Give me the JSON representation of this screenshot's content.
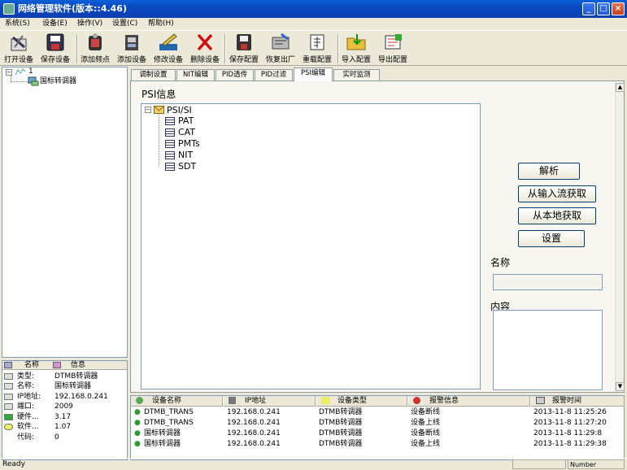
{
  "window": {
    "title": "网络管理软件(版本::4.46)",
    "min": "_",
    "max": "□",
    "close": "×"
  },
  "menu": [
    "系统(S)",
    "设备(E)",
    "操作(V)",
    "设置(C)",
    "帮助(H)"
  ],
  "toolbar": [
    "打开设备",
    "保存设备",
    "添加频点",
    "添加设备",
    "修改设备",
    "删除设备",
    "保存配置",
    "恢复出厂",
    "重载配置",
    "导入配置",
    "导出配置"
  ],
  "tree": {
    "root": "1",
    "child": "国标转调器"
  },
  "props": {
    "col1": "名称",
    "col2": "信息",
    "rows": [
      [
        "类型:",
        "DTMB转调器"
      ],
      [
        "名称:",
        "国标转调器"
      ],
      [
        "IP地址:",
        "192.168.0.241"
      ],
      [
        "端口:",
        "2009"
      ],
      [
        "硬件...",
        "3.17"
      ],
      [
        "软件...",
        "1.07"
      ],
      [
        "代码:",
        "0"
      ]
    ]
  },
  "tabs": [
    "调制设置",
    "NIT编辑",
    "PID透传",
    "PID过滤",
    "PSI编辑",
    "实时监测"
  ],
  "psi": {
    "title": "PSI信息",
    "root": "PSI/SI",
    "items": [
      "PAT",
      "CAT",
      "PMTs",
      "NIT",
      "SDT"
    ]
  },
  "buttons": {
    "parse": "解析",
    "from_input": "从输入流获取",
    "from_local": "从本地获取",
    "set": "设置"
  },
  "labels": {
    "name": "名称",
    "content": "内容"
  },
  "alarms": {
    "headers": [
      "设备名称",
      "IP地址",
      "设备类型",
      "报警信息",
      "报警时间"
    ],
    "rows": [
      [
        "DTMB_TRANS",
        "192.168.0.241",
        "DTMB转调器",
        "设备断线",
        "2013-11-8 11:25:26"
      ],
      [
        "DTMB_TRANS",
        "192.168.0.241",
        "DTMB转调器",
        "设备上线",
        "2013-11-8 11:27:20"
      ],
      [
        "国标转调器",
        "192.168.0.241",
        "DTMB转调器",
        "设备断线",
        "2013-11-8 11:29:8"
      ],
      [
        "国标转调器",
        "192.168.0.241",
        "DTMB转调器",
        "设备上线",
        "2013-11-8 11:29:38"
      ]
    ]
  },
  "status": {
    "left": "Ready",
    "right": "Number"
  }
}
